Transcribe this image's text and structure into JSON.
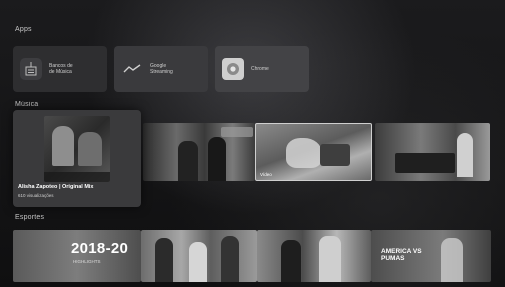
{
  "sections": {
    "apps": "Apps",
    "music": "Música",
    "sports": "Esportes"
  },
  "apps": [
    {
      "label": "Bancos de\nde Música",
      "icon": "radio-tower-icon"
    },
    {
      "label": "Google\nStreaming",
      "icon": "streaming-icon"
    },
    {
      "label": "Chrome",
      "icon": "chrome-icon"
    }
  ],
  "music": {
    "focused": {
      "title": "Alisha Zapoteo | Original Mix",
      "subtitle": "610 visualizações"
    },
    "thumbs": [
      {
        "caption": ""
      },
      {
        "caption": "Vídeo"
      },
      {
        "caption": ""
      }
    ]
  },
  "sports": {
    "thumbs": [
      {
        "title": "2018-20",
        "subtitle": "HIGHLIGHTS"
      },
      {
        "title": "",
        "subtitle": ""
      },
      {
        "title": "",
        "subtitle": ""
      },
      {
        "title": "AMERICA VS PUMAS",
        "subtitle": ""
      }
    ]
  }
}
